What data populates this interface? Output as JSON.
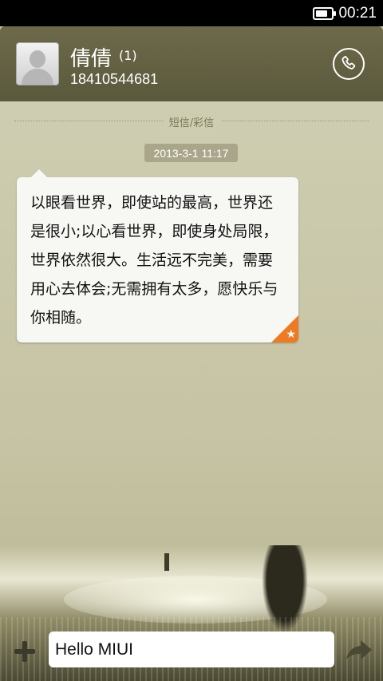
{
  "status_bar": {
    "time": "00:21"
  },
  "contact": {
    "name": "倩倩",
    "unread_count": "(1)",
    "phone": "18410544681"
  },
  "conversation": {
    "divider_label": "短信/彩信",
    "timestamp": "2013-3-1 11:17",
    "message_text": "以眼看世界，即使站的最高，世界还是很小;以心看世界，即使身处局限，世界依然很大。生活远不完美，需要用心去体会;无需拥有太多，愿快乐与你相随。",
    "star_glyph": "★",
    "star_color": "#ee7b22"
  },
  "composer": {
    "input_value": "Hello MIUI"
  },
  "icons": {
    "call": "call-icon",
    "plus": "plus-icon",
    "send": "send-arrow-icon",
    "avatar": "default-avatar-icon",
    "battery": "battery-icon"
  },
  "colors": {
    "header": "#5b593c",
    "bubble": "#f7f7f4",
    "timestamp_bg": "#a9a689",
    "accent": "#ee7b22"
  }
}
